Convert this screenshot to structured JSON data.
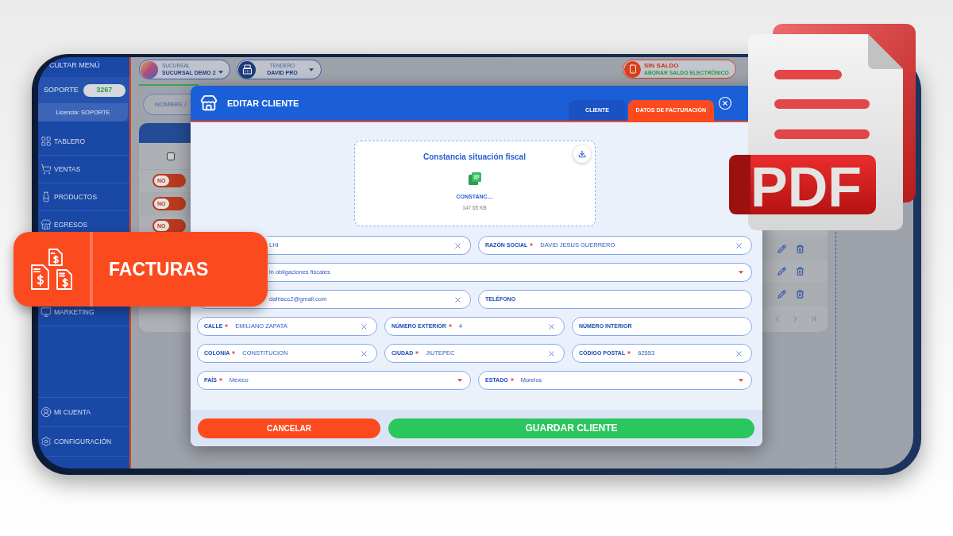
{
  "promo_banner": {
    "title": "FACTURAS"
  },
  "file_badge": {
    "label": "PDF"
  },
  "sidebar": {
    "toggle_label": "CULTAR MENÚ",
    "user": {
      "name": "SOPORTE",
      "count": "3267"
    },
    "license": "Licencia: SOPORTE",
    "menu": [
      {
        "label": "TABLERO"
      },
      {
        "label": "VENTAS"
      },
      {
        "label": "PRODUCTOS"
      },
      {
        "label": "EGRESOS"
      }
    ],
    "menu_lower": [
      {
        "label": "MARKETING"
      }
    ],
    "account_menu": [
      {
        "label": "MI CUENTA"
      },
      {
        "label": "CONFIGURACIÓN"
      }
    ]
  },
  "topbar": {
    "branch": {
      "caption": "SUCURSAL",
      "value": "SUCURSAL DEMO 2"
    },
    "cashier": {
      "caption": "TENDERO",
      "value": "DAVID PRO"
    },
    "balance": {
      "status": "SIN SALDO",
      "action": "ABONAR SALDO ELECTRÓNICO"
    }
  },
  "search": {
    "placeholder": "NOMBRE /"
  },
  "table": {
    "select_all": {
      "checked": false
    },
    "rows": [
      {
        "kind": "toggle",
        "label": "NO",
        "on": false
      },
      {
        "kind": "toggle",
        "label": "NO",
        "on": false
      },
      {
        "kind": "toggle",
        "label": "NO",
        "on": false
      },
      {
        "kind": "actions"
      },
      {
        "kind": "actions"
      },
      {
        "kind": "actions"
      }
    ]
  },
  "modal": {
    "title": "EDITAR CLIENTE",
    "tabs": [
      {
        "label": "CLIENTE",
        "selected": false
      },
      {
        "label": "DATOS DE FACTURACIÓN",
        "selected": true
      }
    ],
    "upload": {
      "title": "Constancia situación fiscal",
      "file_name": "CONSTANC…",
      "file_size": "147.65 KB"
    },
    "form_rows": [
      {
        "fields": [
          {
            "kind": "text",
            "value": "LHI"
          },
          {
            "kind": "text",
            "label": "RAZÓN SOCIAL",
            "required": true,
            "value": "DAVID JESUS GUERRERO"
          }
        ]
      },
      {
        "fields": [
          {
            "kind": "select",
            "value": "in obligaciones fiscales"
          }
        ]
      },
      {
        "fields": [
          {
            "kind": "text",
            "value": "dafriacc2@gmail.com"
          },
          {
            "kind": "text",
            "label": "TELÉFONO",
            "required": false
          }
        ]
      },
      {
        "fields": [
          {
            "kind": "text",
            "label": "CALLE",
            "required": true,
            "value": "EMILIANO ZAPATA"
          },
          {
            "kind": "text",
            "label": "NÚMERO EXTERIOR",
            "required": true,
            "value": "4"
          },
          {
            "kind": "text",
            "label": "NÚMERO INTERIOR",
            "required": false
          }
        ]
      },
      {
        "fields": [
          {
            "kind": "text",
            "label": "COLONIA",
            "required": true,
            "value": "CONSTITUCION"
          },
          {
            "kind": "text",
            "label": "CIUDAD",
            "required": true,
            "value": "JIUTEPEC"
          },
          {
            "kind": "text",
            "label": "CÓDIGO POSTAL",
            "required": true,
            "value": "62553"
          }
        ]
      },
      {
        "fields": [
          {
            "kind": "select",
            "label": "PAÍS",
            "required": true,
            "value": "México"
          },
          {
            "kind": "select",
            "label": "ESTADO",
            "required": true,
            "value": "Morelos"
          }
        ]
      }
    ],
    "buttons": [
      {
        "kind": "cancel",
        "label": "CANCELAR"
      },
      {
        "kind": "save",
        "label": "GUARDAR CLIENTE"
      }
    ]
  }
}
